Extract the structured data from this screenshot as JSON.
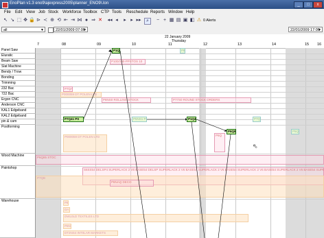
{
  "window": {
    "title": "EnoPlan v1.3   eno9\\ajexpress2005\\planner_ENO9\\.lon",
    "min": "_",
    "max": "□",
    "close": "x"
  },
  "menu": [
    "File",
    "Edit",
    "View",
    "Job",
    "Stock",
    "Workforce",
    "Toolbox",
    "CTP",
    "Tools",
    "Reschedule",
    "Reports",
    "Window",
    "Help"
  ],
  "toolbar": {
    "alerts": "0 Alerts"
  },
  "selectors": {
    "area": "all",
    "start_date": "22/01/2009 07:00",
    "end_date": "22/01/2009 17:00"
  },
  "timeline": {
    "date": "22 January 2009",
    "day": "Thursday",
    "hours": [
      "7",
      "08",
      "09",
      "10",
      "11",
      "12",
      "13",
      "14",
      "15",
      "16",
      "1"
    ]
  },
  "resources": [
    "Panel Saw",
    "Eluratic",
    "Beam Saw",
    "Slat Machine",
    "Bendy / Trow",
    "Bonding",
    "Trimming",
    "232 Bac",
    "722 Bac",
    "Ergon CNC",
    "Anderson CNC",
    "KAL1 Edgeband",
    "KAL2 Edgeband",
    "pin & cam",
    "Postforming",
    "Wood Machine",
    "Paintshop",
    "Warehouse"
  ],
  "jobs": {
    "j1": "P1Q4",
    "j2": "P100/100-PPSTOS 10",
    "j3": "P7QAL2 PS",
    "j4": "P7Q41 PS",
    "j5": "P8NS0 ROLLING STOCK",
    "j6": "P77S0 ROUND STOCK ORDERS",
    "j7": "P5NS1 PS",
    "j8": "P1Q4",
    "j9": "P7Q",
    "j10": "P6Q9",
    "j11": "P5Q",
    "j12": "P6Q",
    "j13": "P000059 DT POLEN LTD",
    "j14": "P7QB",
    "j15": "P6Q85 STOC",
    "j16": "S6SS54 DELSP4 SUPERLACK 2 V6 BASE54 DELSP SUPERLACK 2 V6 BASE54 SUPERLACK 2 V6 BASE54 SUPERLACK 2 V6 BASE54 SUPERLACK 2 V6 BASE54 SUPERL",
    "j17": "P8NAQ DECO",
    "j18": "P8",
    "j19": "DA",
    "j20": "DWL0LD TEXTILES LTD",
    "j21": "P6NS2",
    "j22": "DT2NS4 INT0LAR MARKETS"
  },
  "colors": {
    "title": "#2b4f86",
    "chrome": "#f0f0f0",
    "weekend_gray": "#d8d8d8",
    "job_green": "#1c6b12",
    "job_pink": "#e59ab3",
    "job_peach": "#fde0be"
  }
}
